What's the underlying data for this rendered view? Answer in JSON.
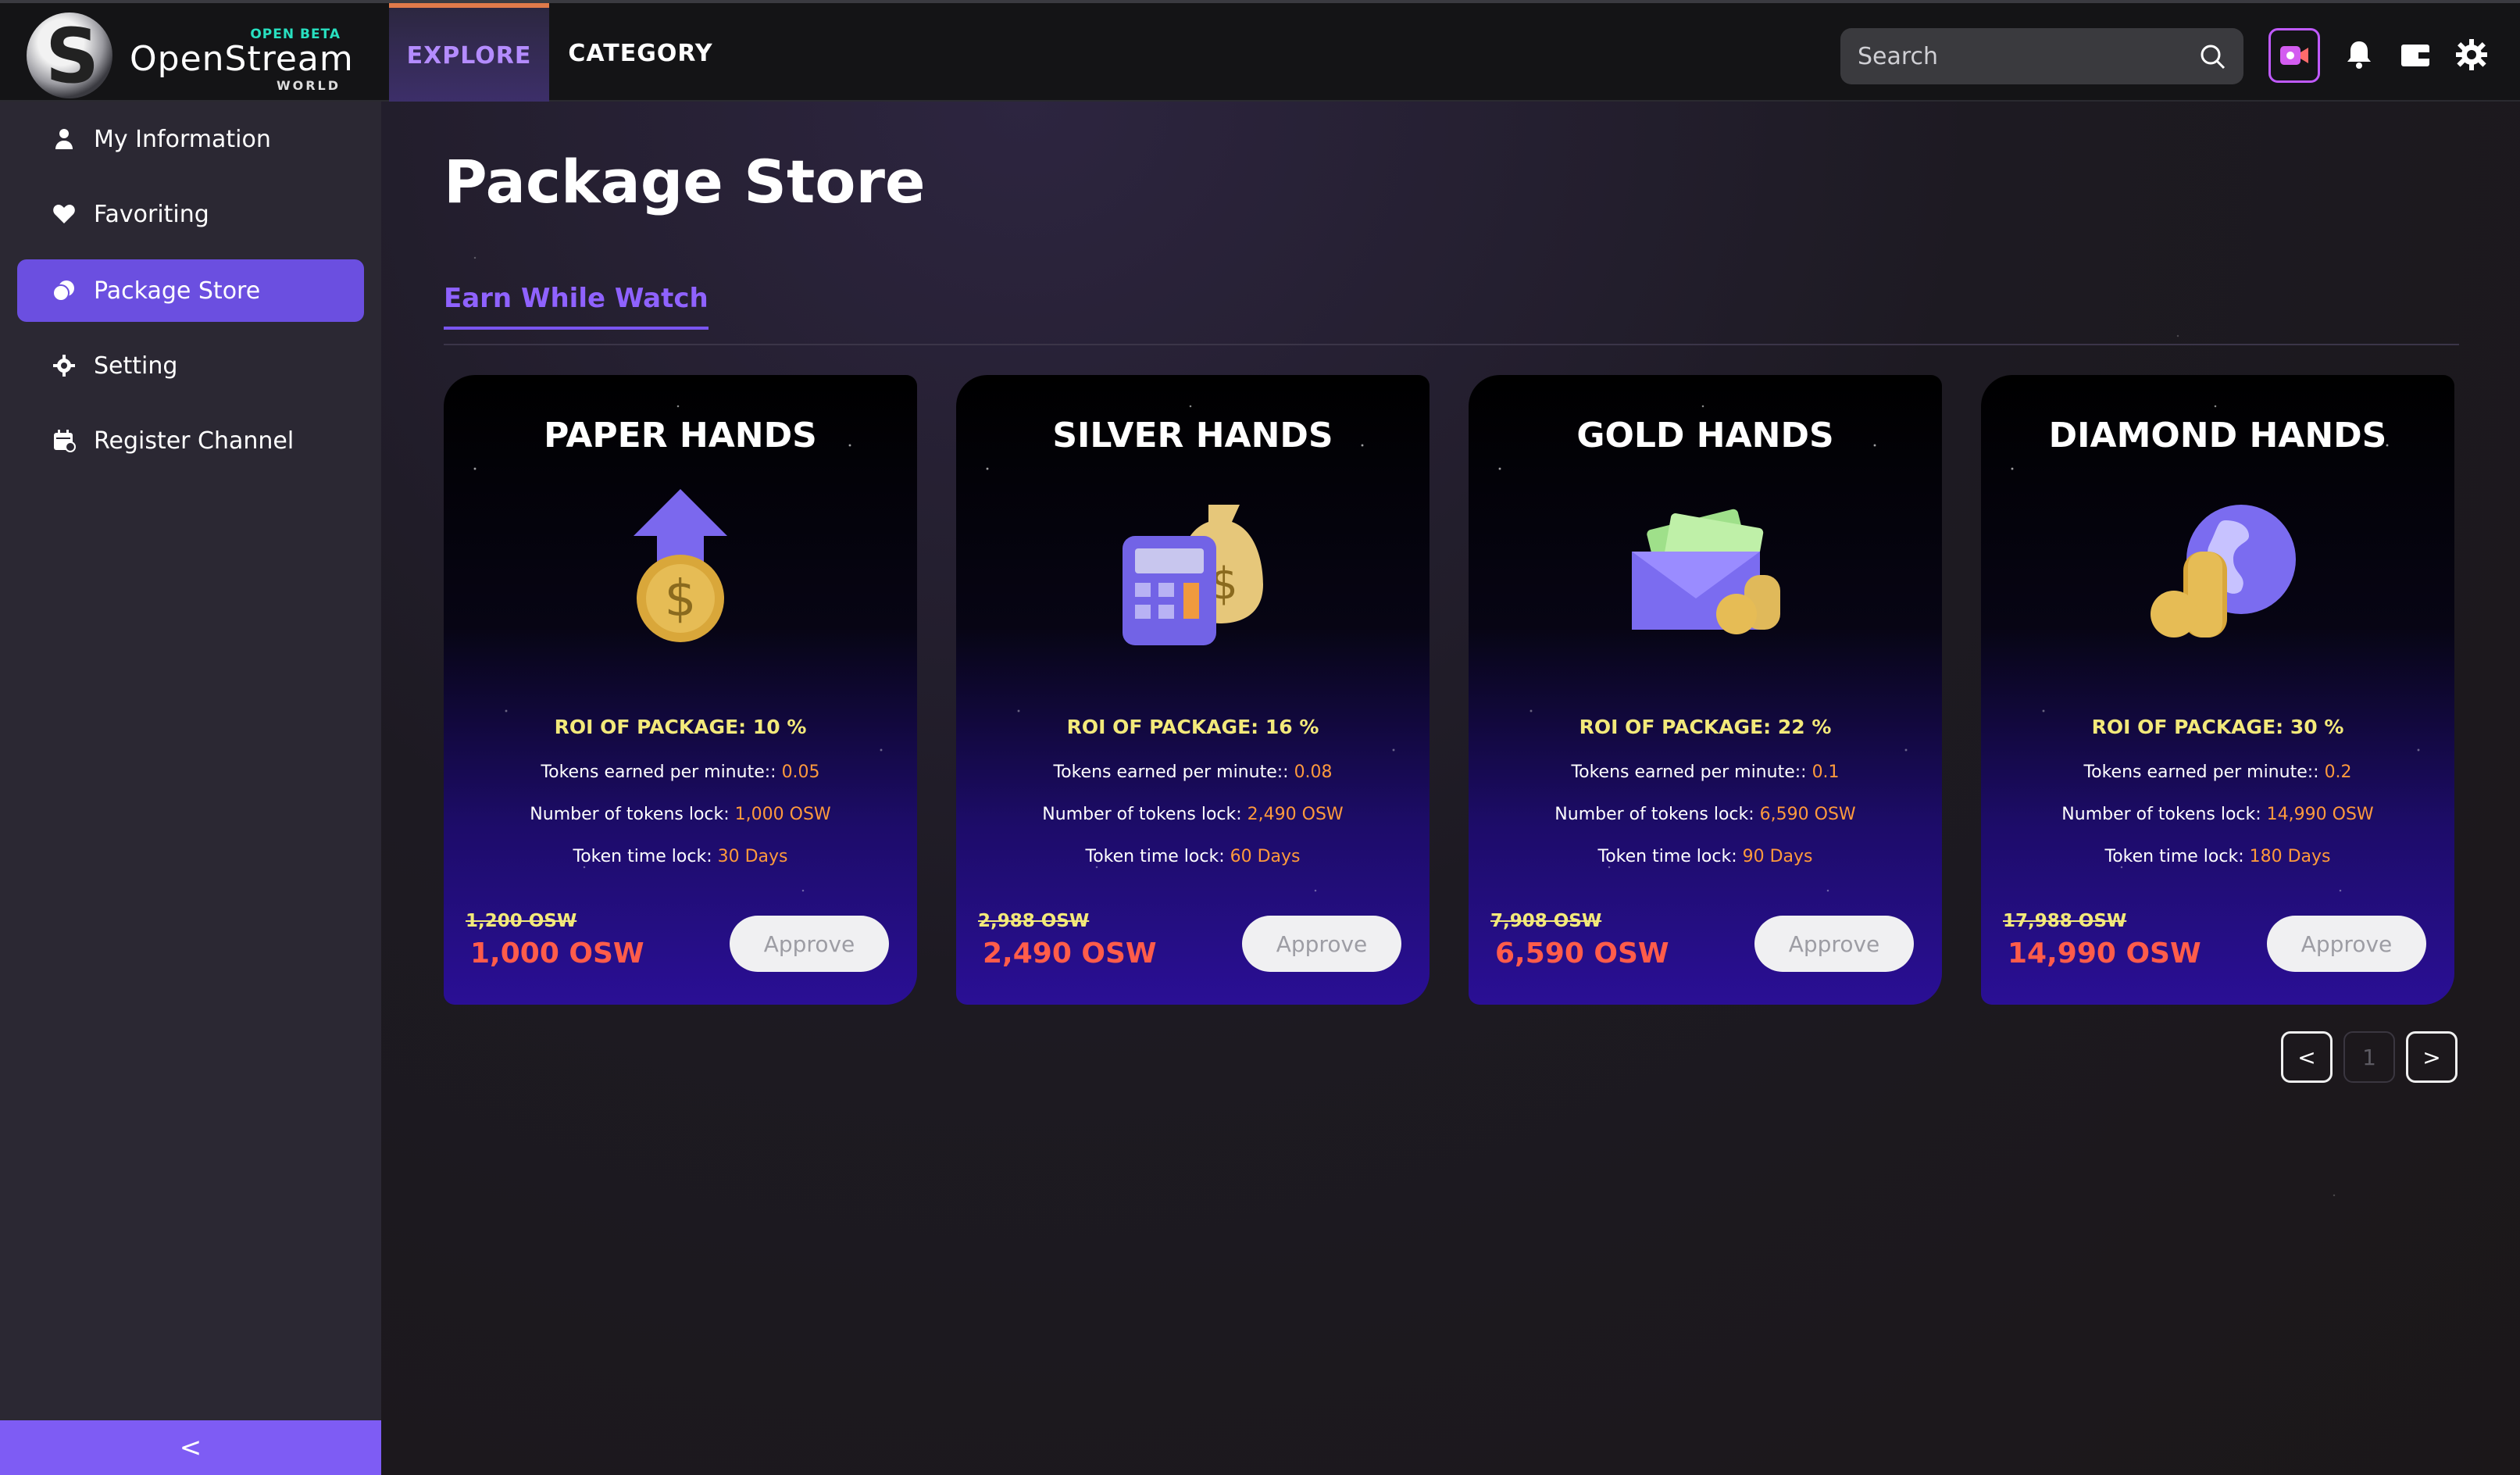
{
  "brand": {
    "name": "OpenStream",
    "badge": "OPEN BETA",
    "suffix": "WORLD"
  },
  "nav": {
    "tabs": [
      {
        "label": "EXPLORE",
        "active": true
      },
      {
        "label": "CATEGORY",
        "active": false
      }
    ]
  },
  "search": {
    "placeholder": "Search",
    "value": ""
  },
  "toolbar": {
    "icons": [
      "live-stream-icon",
      "bell-icon",
      "wallet-icon",
      "gear-icon"
    ]
  },
  "sidebar": {
    "items": [
      {
        "label": "My Information",
        "icon": "user-icon",
        "active": false
      },
      {
        "label": "Favoriting",
        "icon": "heart-icon",
        "active": false
      },
      {
        "label": "Package Store",
        "icon": "coins-icon",
        "active": true
      },
      {
        "label": "Setting",
        "icon": "gear-icon",
        "active": false
      },
      {
        "label": "Register Channel",
        "icon": "calendar-icon",
        "active": false
      }
    ],
    "collapse": "<"
  },
  "main": {
    "title": "Package Store",
    "subtab": "Earn While Watch",
    "labels": {
      "roi": "ROI OF PACKAGE:",
      "tokens_per_minute": "Tokens earned per minute::",
      "tokens_lock": "Number of tokens lock:",
      "time_lock": "Token time lock:",
      "approve": "Approve"
    },
    "packages": [
      {
        "title": "PAPER HANDS",
        "icon": "dollar-coin-arrow-up-icon",
        "roi": "10 %",
        "tokens_per_minute": "0.05",
        "tokens_lock": "1,000 OSW",
        "time_lock": "30 Days",
        "old_price": "1,200 OSW",
        "price": "1,000 OSW"
      },
      {
        "title": "SILVER HANDS",
        "icon": "calculator-money-bag-icon",
        "roi": "16 %",
        "tokens_per_minute": "0.08",
        "tokens_lock": "2,490 OSW",
        "time_lock": "60 Days",
        "old_price": "2,988 OSW",
        "price": "2,490 OSW"
      },
      {
        "title": "GOLD HANDS",
        "icon": "cash-envelope-coins-icon",
        "roi": "22 %",
        "tokens_per_minute": "0.1",
        "tokens_lock": "6,590 OSW",
        "time_lock": "90 Days",
        "old_price": "7,908 OSW",
        "price": "6,590 OSW"
      },
      {
        "title": "DIAMOND HANDS",
        "icon": "globe-coins-icon",
        "roi": "30 %",
        "tokens_per_minute": "0.2",
        "tokens_lock": "14,990 OSW",
        "time_lock": "180 Days",
        "old_price": "17,988 OSW",
        "price": "14,990 OSW"
      }
    ],
    "pagination": {
      "prev": "<",
      "page": "1",
      "next": ">"
    }
  },
  "colors": {
    "accent": "#6b4fe0",
    "highlight": "#f3e97a",
    "value": "#ff9a3c",
    "price": "#ff5c4a"
  }
}
